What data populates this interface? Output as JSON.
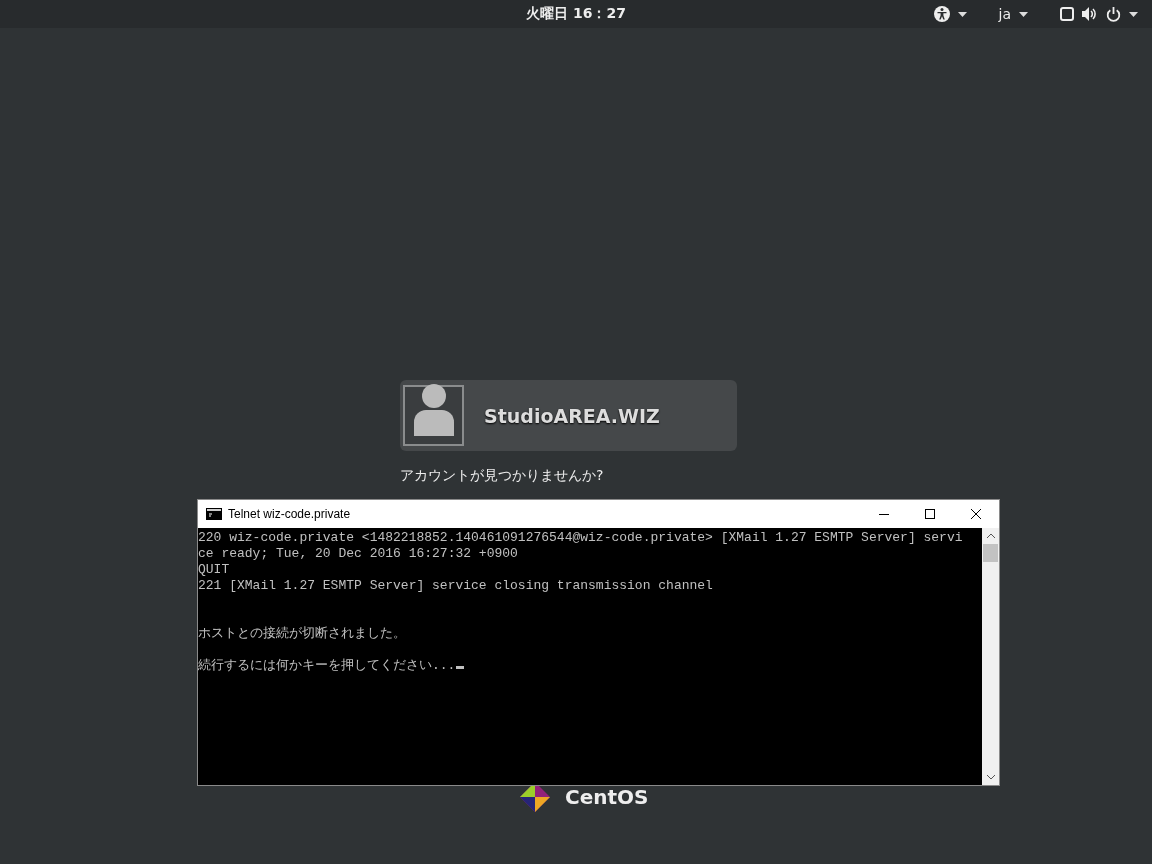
{
  "top_bar": {
    "clock": "火曜日 16：27",
    "language": "ja"
  },
  "login": {
    "user_name": "StudioAREA.WIZ",
    "not_listed": "アカウントが見つかりませんか?"
  },
  "branding": {
    "logo_text": "CentOS"
  },
  "terminal_window": {
    "title": "Telnet wiz-code.private",
    "blocks": [
      [
        "220 wiz-code.private <1482218852.140461091276544@wiz-code.private> [XMail 1.27 ESMTP Server] servi",
        "ce ready; Tue, 20 Dec 2016 16:27:32 +0900",
        "QUIT",
        "221 [XMail 1.27 ESMTP Server] service closing transmission channel"
      ],
      [
        "ホストとの接続が切断されました。"
      ],
      [
        "続行するには何かキーを押してください..."
      ]
    ],
    "cursor": true
  }
}
